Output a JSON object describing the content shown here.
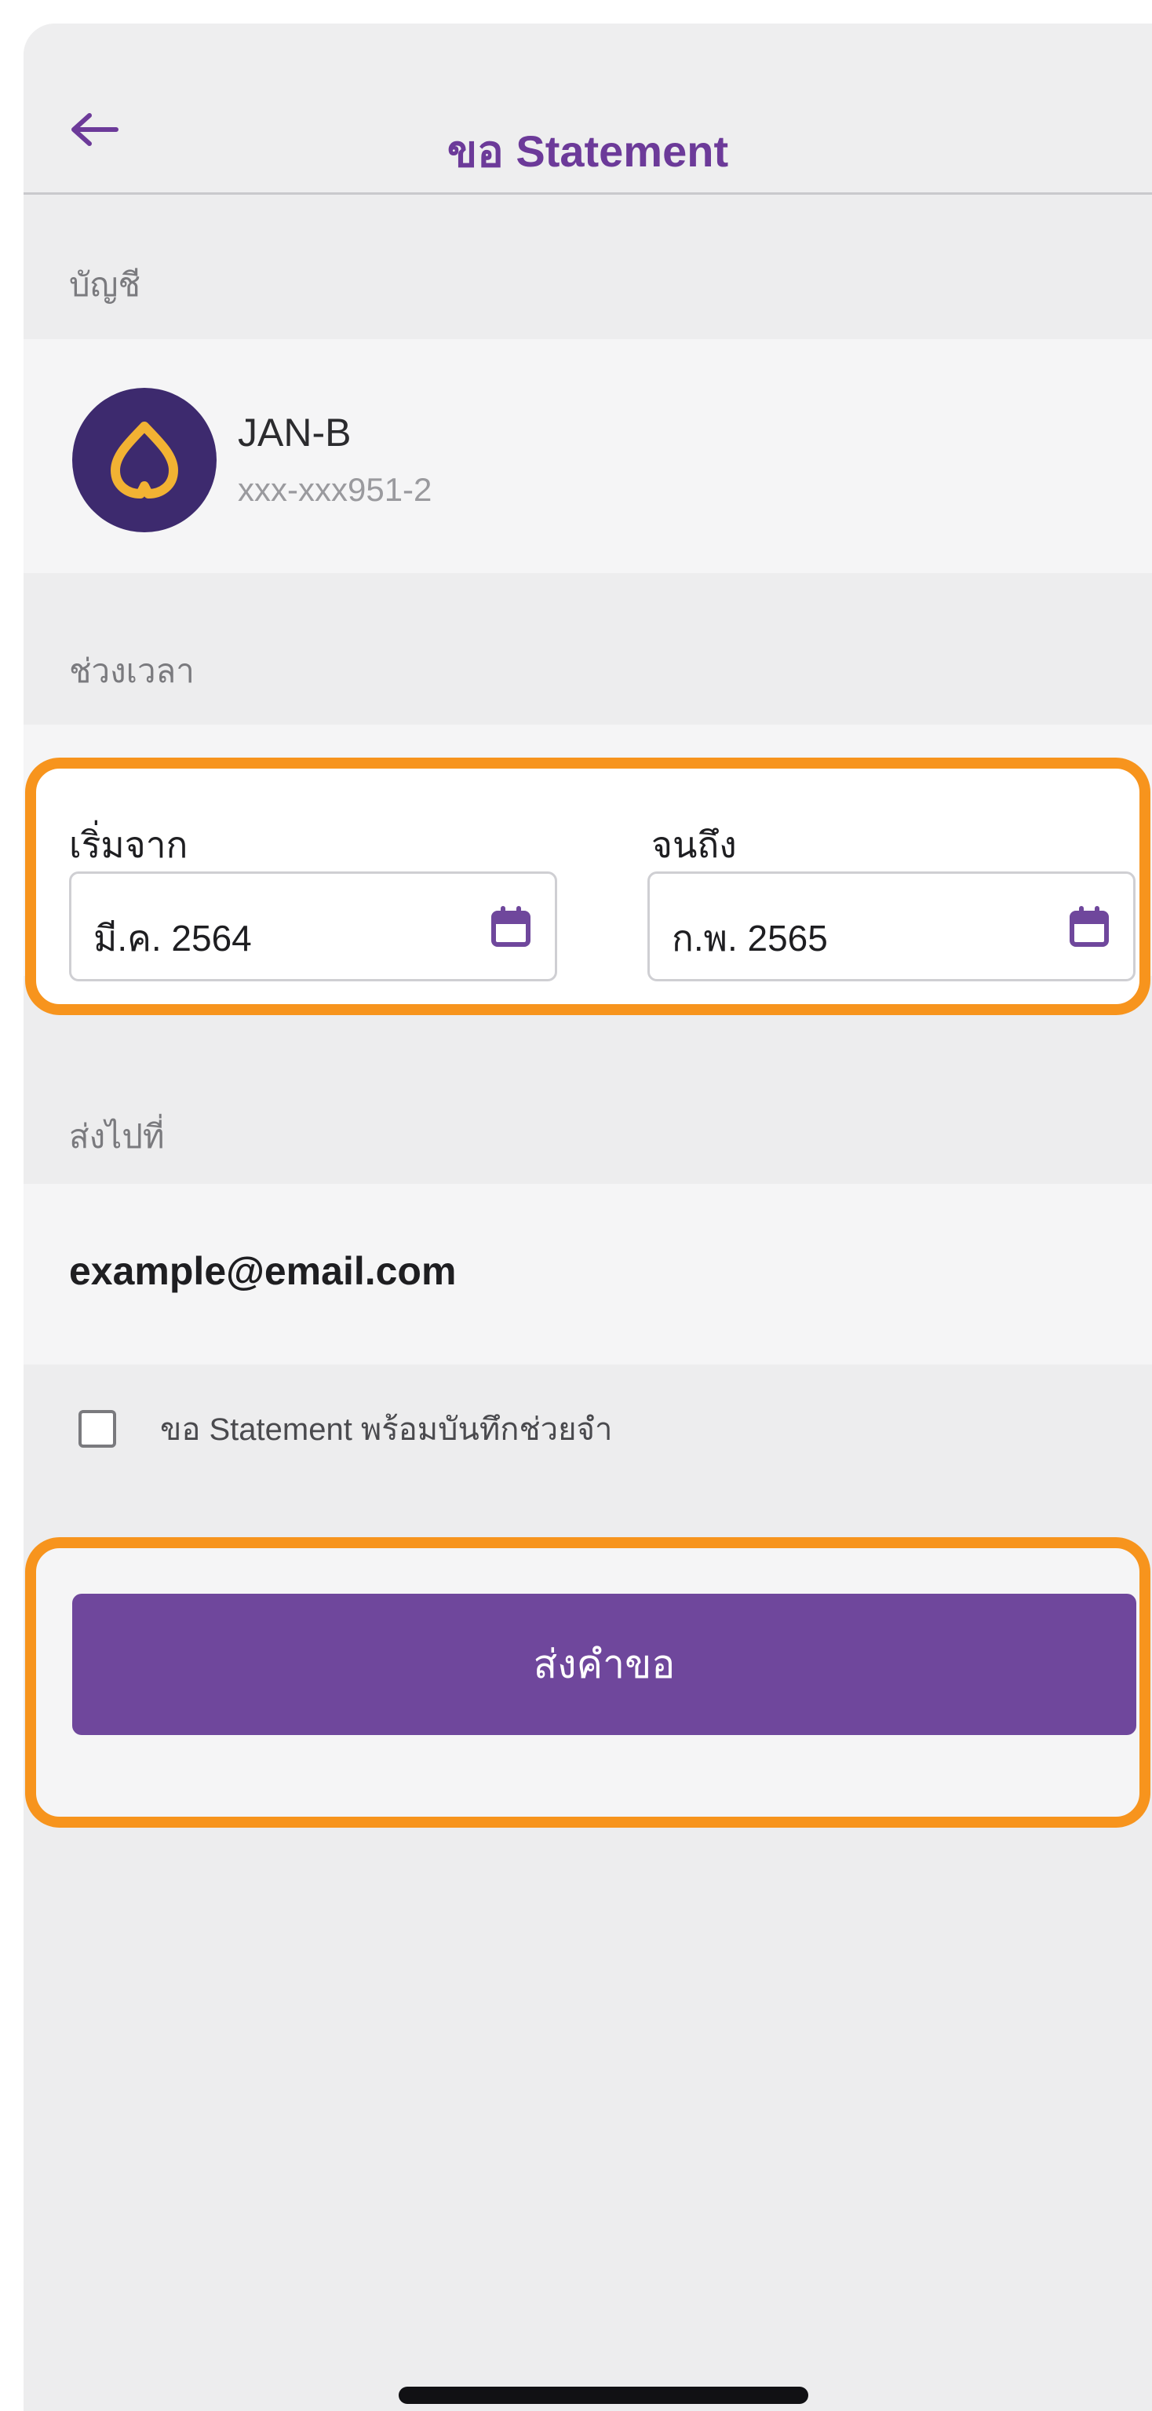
{
  "header": {
    "title": "ขอ Statement",
    "back_icon": "arrow-left-icon"
  },
  "sections": {
    "account_label": "บัญชี",
    "period_label": "ช่วงเวลา",
    "send_to_label": "ส่งไปที่"
  },
  "account": {
    "name": "JAN-B",
    "number": "xxx-xxx951-2",
    "avatar_icon": "bank-logo-icon"
  },
  "date_range": {
    "from_label": "เริ่มจาก",
    "from_value": "มี.ค. 2564",
    "to_label": "จนถึง",
    "to_value": "ก.พ. 2565",
    "calendar_icon": "calendar-icon"
  },
  "send_to": {
    "email": "example@email.com"
  },
  "memo_option": {
    "label": "ขอ Statement พร้อมบันทึกช่วยจำ",
    "checked": false
  },
  "submit": {
    "label": "ส่งคำขอ"
  },
  "colors": {
    "accent": "#6f479c",
    "title": "#6c3a99",
    "highlight": "#f7941d",
    "avatar_bg": "#3d2a6e",
    "logo_gold": "#f2b233"
  }
}
